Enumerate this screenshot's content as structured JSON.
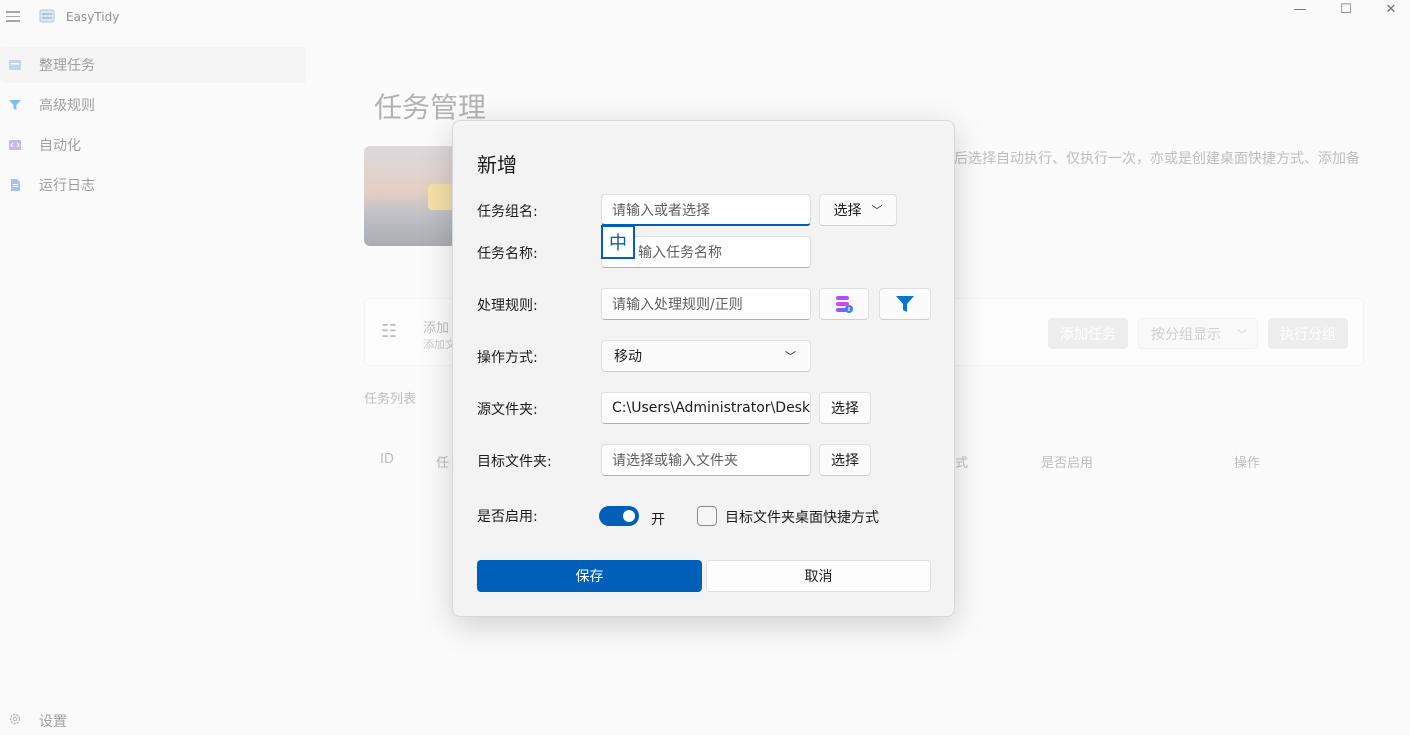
{
  "app": {
    "title": "EasyTidy",
    "icon": "app-icon"
  },
  "window": {
    "minimize": "—",
    "maximize": "☐",
    "close": "✕"
  },
  "sidebar": {
    "items": [
      {
        "label": "整理任务",
        "icon": "task-icon",
        "selected": true
      },
      {
        "label": "高级规则",
        "icon": "filter-icon",
        "selected": false
      },
      {
        "label": "自动化",
        "icon": "code-icon",
        "selected": false
      },
      {
        "label": "运行日志",
        "icon": "log-icon",
        "selected": false
      }
    ],
    "settings": {
      "label": "设置",
      "icon": "gear-icon"
    }
  },
  "main": {
    "title": "任务管理",
    "description": "后选择自动执行、仅执行一次，亦或是创建桌面快捷方式、添加备",
    "card": {
      "title": "添加",
      "subtitle": "添加文",
      "add_task": "添加任务",
      "group_display": "按分组显示",
      "exec_group": "执行分组"
    },
    "list_label": "任务列表",
    "columns": [
      "ID",
      "任",
      "式",
      "是否启用",
      "操作"
    ]
  },
  "dialog": {
    "title": "新增",
    "group_name": {
      "label": "任务组名:",
      "placeholder": "请输入或者选择",
      "select": "选择"
    },
    "ime_indicator": "中",
    "task_name": {
      "label": "任务名称:",
      "placeholder": "输入任务名称"
    },
    "rule": {
      "label": "处理规则:",
      "placeholder": "请输入处理规则/正则"
    },
    "operation": {
      "label": "操作方式:",
      "value": "移动"
    },
    "source": {
      "label": "源文件夹:",
      "value": "C:\\Users\\Administrator\\Desktop",
      "select": "选择"
    },
    "target": {
      "label": "目标文件夹:",
      "placeholder": "请选择或输入文件夹",
      "select": "选择"
    },
    "enabled": {
      "label": "是否启用:",
      "toggle_text": "开",
      "on": true
    },
    "shortcut": {
      "label": "目标文件夹桌面快捷方式",
      "checked": false
    },
    "save": "保存",
    "cancel": "取消"
  },
  "colors": {
    "accent": "#005fb8",
    "rule_icon": "#8b5cf6",
    "filter_icon": "#0078d4"
  }
}
